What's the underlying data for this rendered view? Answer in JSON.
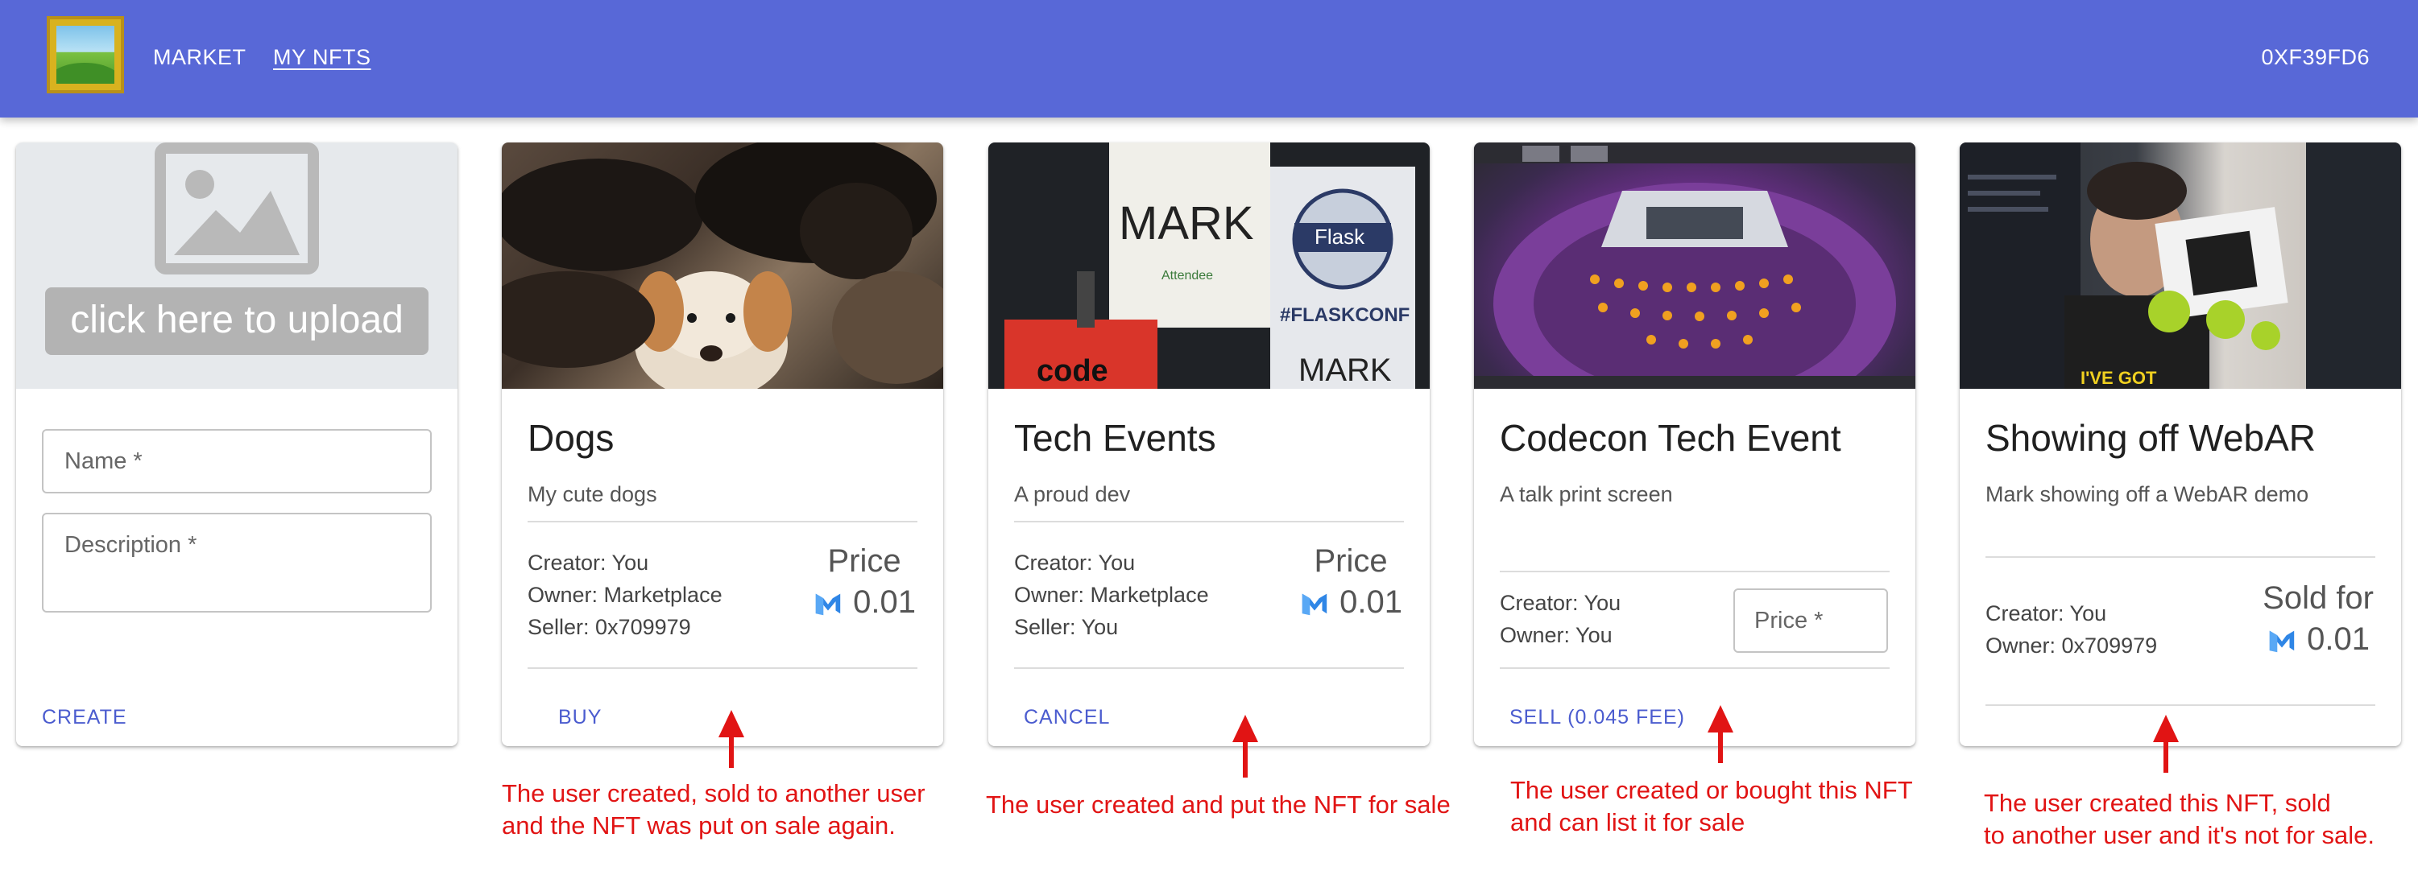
{
  "nav": {
    "market": "MARKET",
    "my_nfts": "MY NFTS",
    "account": "0XF39FD6"
  },
  "create_card": {
    "upload_label": "click here to upload",
    "name_placeholder": "Name *",
    "description_placeholder": "Description *",
    "action": "CREATE"
  },
  "cards": [
    {
      "title": "Dogs",
      "description": "My cute dogs",
      "creator": "Creator: You",
      "owner": "Owner: Marketplace",
      "seller": "Seller: 0x709979",
      "price_label": "Price",
      "price_value": "0.01",
      "action": "BUY",
      "note_line1": "The user created, sold to another user",
      "note_line2": "and the NFT was put on sale again."
    },
    {
      "title": "Tech Events",
      "description": "A proud dev",
      "creator": "Creator: You",
      "owner": "Owner: Marketplace",
      "seller": "Seller: You",
      "price_label": "Price",
      "price_value": "0.01",
      "action": "CANCEL",
      "note_line1": "The user created and put the NFT for sale"
    },
    {
      "title": "Codecon Tech Event",
      "description": "A talk print screen",
      "creator": "Creator: You",
      "owner": "Owner: You",
      "price_placeholder": "Price *",
      "action": "SELL (0.045 FEE)",
      "note_line1": "The user created or bought this NFT",
      "note_line2": "and can list it for sale"
    },
    {
      "title": "Showing off WebAR",
      "description": "Mark showing off a WebAR demo",
      "creator": "Creator: You",
      "owner": "Owner: 0x709979",
      "price_label": "Sold for",
      "price_value": "0.01",
      "note_line1": "The user created this NFT, sold",
      "note_line2": "to another user and it's not for sale."
    }
  ],
  "photo_text": {
    "badge_name": "MARK",
    "badge_attendee": "Attendee",
    "flask": "Flask",
    "flaskconf": "#FLASKCONF",
    "mark2": "MARK",
    "code": "code",
    "shirt": "I'VE GOT"
  },
  "colors": {
    "appbar": "#5868d7",
    "accent": "#4b5ccf",
    "annotation": "#e11414"
  }
}
